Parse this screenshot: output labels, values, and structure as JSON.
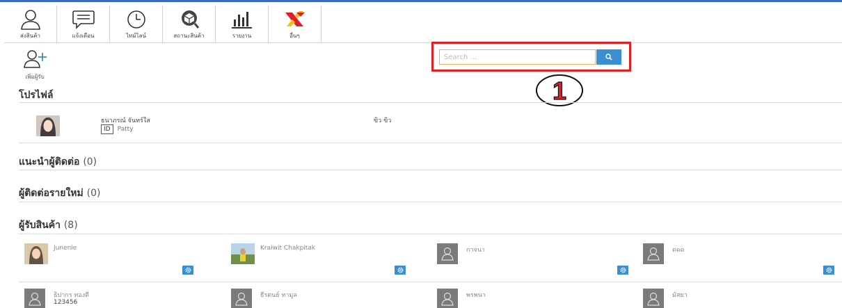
{
  "nav": {
    "items": [
      {
        "label": "ส่งสินค้า",
        "icon": "user-icon"
      },
      {
        "label": "แจ้งเตือน",
        "icon": "message-icon"
      },
      {
        "label": "ไทม์ไลน์",
        "icon": "clock-icon"
      },
      {
        "label": "สถานะสินค้า",
        "icon": "box-icon"
      },
      {
        "label": "รายงาน",
        "icon": "bar-chart-icon"
      },
      {
        "label": "อื่นๆ",
        "icon": "logo-icon"
      }
    ]
  },
  "add_recipient": {
    "label": "เพิ่มผู้รับ"
  },
  "search": {
    "placeholder": "Search ..."
  },
  "callout": {
    "number": "1"
  },
  "colors": {
    "accent": "#3b8ed0",
    "highlight": "#e21f26",
    "input_border": "#f0b35a"
  },
  "profile": {
    "title": "โปรไฟล์",
    "name": "ธนาภรณ์ จันทร์ใส",
    "id_badge": "ID",
    "id_value": "Patty",
    "nickname": "ขิว ขิว"
  },
  "sections": {
    "suggested": {
      "title": "แนะนำผู้ติดต่อ",
      "count": "(0)"
    },
    "new_contacts": {
      "title": "ผู้ติดต่อรายใหม่",
      "count": "(0)"
    },
    "recipients": {
      "title": "ผู้รับสินค้า",
      "count": "(8)"
    }
  },
  "recipients": [
    {
      "name": "Junenie",
      "sub": "",
      "photo": "photo"
    },
    {
      "name": "Kraiwit Chakpitak",
      "sub": "",
      "photo": "photo"
    },
    {
      "name": "กาจนา",
      "sub": "",
      "photo": "default-avatar"
    },
    {
      "name": "ดดด",
      "sub": "",
      "photo": "default-avatar"
    },
    {
      "name": "ธิปากร ทองดี",
      "sub": "123456",
      "photo": "default-avatar"
    },
    {
      "name": "ธีรตนย์ ทามูล",
      "sub": "",
      "photo": "default-avatar"
    },
    {
      "name": "พรพนา",
      "sub": "",
      "photo": "default-avatar"
    },
    {
      "name": "มัสยา",
      "sub": "",
      "photo": "default-avatar"
    }
  ]
}
